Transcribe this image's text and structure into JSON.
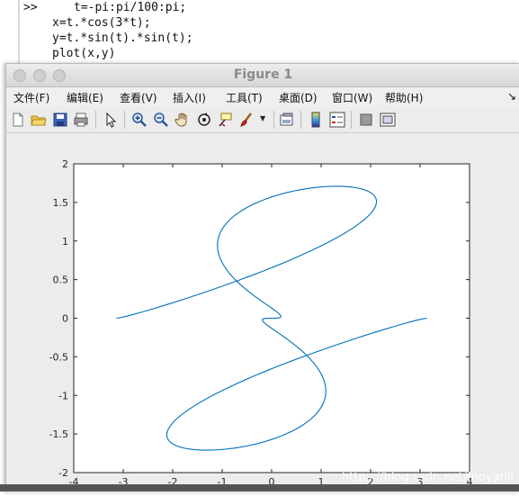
{
  "command_window": {
    "prompt": ">>",
    "lines": [
      "t=-pi:pi/100:pi;",
      "x=t.*cos(3*t);",
      "y=t.*sin(t).*sin(t);",
      "plot(x,y)"
    ]
  },
  "figure": {
    "title": "Figure 1",
    "menu": [
      "文件(F)",
      "编辑(E)",
      "查看(V)",
      "插入(I)",
      "工具(T)",
      "桌面(D)",
      "窗口(W)",
      "帮助(H)"
    ],
    "menu_overflow": "↘",
    "toolbar_icons": [
      "new-figure-icon",
      "open-file-icon",
      "save-icon",
      "print-icon",
      "pointer-icon",
      "zoom-in-icon",
      "zoom-out-icon",
      "pan-icon",
      "rotate-icon",
      "data-cursor-icon",
      "brush-icon",
      "link-plot-icon",
      "colorbar-icon",
      "legend-icon",
      "hide-tools-icon",
      "show-tools-icon"
    ]
  },
  "chart_data": {
    "type": "line",
    "title": "",
    "xlabel": "",
    "ylabel": "",
    "xlim": [
      -4,
      4
    ],
    "ylim": [
      -2,
      2
    ],
    "xticks": [
      "-4",
      "-3",
      "-2",
      "-1",
      "0",
      "1",
      "2",
      "3",
      "4"
    ],
    "yticks": [
      "-2",
      "-1.5",
      "-1",
      "-0.5",
      "0",
      "0.5",
      "1",
      "1.5",
      "2"
    ],
    "grid": false,
    "series_color": "#0072bd",
    "expression": {
      "t_range": [
        -3.14159,
        3.14159
      ],
      "t_step": 0.0314159,
      "x": "t*cos(3t)",
      "y": "t*sin(t)*sin(t)"
    }
  },
  "watermark": "https://blog.csdn.net/fnoyanli"
}
